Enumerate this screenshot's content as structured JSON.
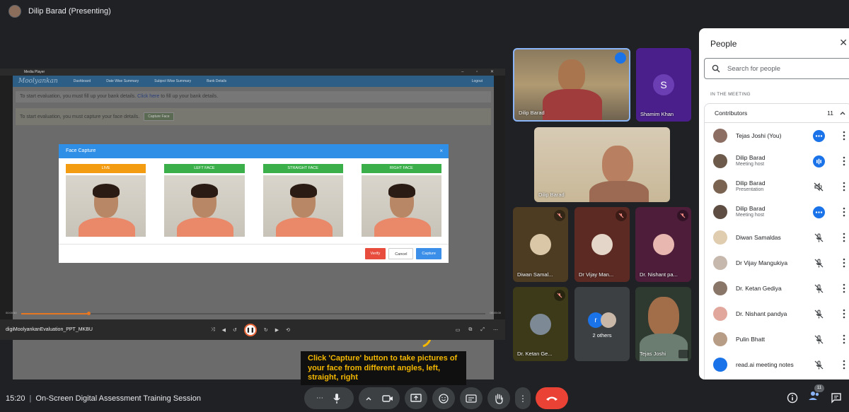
{
  "presenter": {
    "name": "Dilip Barad (Presenting)"
  },
  "shared_screen": {
    "player_title": "Media Player",
    "site_logo": "Moolyankan",
    "nav_items": [
      "Dashboard",
      "Date Wise Summary",
      "Subject Wise Summary",
      "Bank Details"
    ],
    "nav_right": "Logout",
    "bank_alert_text": "To start evaluation, you must fill up your bank details.",
    "bank_alert_link": "Click here",
    "bank_alert_tail": "to fill up your bank details.",
    "face_alert_text": "To start evaluation, you must capture your face details.",
    "face_alert_button": "Capture Face",
    "modal": {
      "title": "Face Capture",
      "labels": [
        "LIVE",
        "LEFT FACE",
        "STRAIGHT FACE",
        "RIGHT FACE"
      ],
      "verify": "Verify",
      "cancel": "Cancel",
      "capture": "Capture"
    },
    "callout": "Click 'Capture' button to take pictures of your face from different angles, left, straight, right",
    "time_elapsed": "00:00:50",
    "time_total": "00:05:00",
    "progress": 0.145,
    "file_name": "digiMoolyankanEvaluation_PPT_MKBU"
  },
  "tiles": {
    "dilip1": "Dilip Barad",
    "shamim": "Shamim Khan",
    "shamim_initial": "S",
    "dilip2": "Dilip Barad",
    "diwan": "Diwan Samal...",
    "vijay": "Dr Vijay Man...",
    "nishant": "Dr. Nishant pa...",
    "ketan": "Dr. Ketan Ge...",
    "others": "2 others",
    "others_initial": "r",
    "tejas": "Tejas Joshi"
  },
  "people_panel": {
    "title": "People",
    "search_placeholder": "Search for people",
    "section": "IN THE MEETING",
    "group_title": "Contributors",
    "group_count": "11",
    "members": [
      {
        "name": "Tejas Joshi (You)",
        "sub": "",
        "status": "more"
      },
      {
        "name": "Dilip Barad",
        "sub": "Meeting host",
        "status": "speaking"
      },
      {
        "name": "Dilip Barad",
        "sub": "Presentation",
        "status": "sound-off"
      },
      {
        "name": "Dilip Barad",
        "sub": "Meeting host",
        "status": "more"
      },
      {
        "name": "Diwan Samaldas",
        "sub": "",
        "status": "muted"
      },
      {
        "name": "Dr Vijay Mangukiya",
        "sub": "",
        "status": "muted"
      },
      {
        "name": "Dr. Ketan Gediya",
        "sub": "",
        "status": "muted"
      },
      {
        "name": "Dr. Nishant pandya",
        "sub": "",
        "status": "muted"
      },
      {
        "name": "Pulin Bhatt",
        "sub": "",
        "status": "muted"
      },
      {
        "name": "read.ai meeting notes",
        "sub": "",
        "status": "muted"
      }
    ]
  },
  "bottom_bar": {
    "time": "15:20",
    "meeting_title": "On-Screen Digital Assessment Training Session",
    "people_badge": "11"
  },
  "colors": {
    "accent": "#1a73e8",
    "end_call": "#ea4335",
    "background": "#202124"
  }
}
